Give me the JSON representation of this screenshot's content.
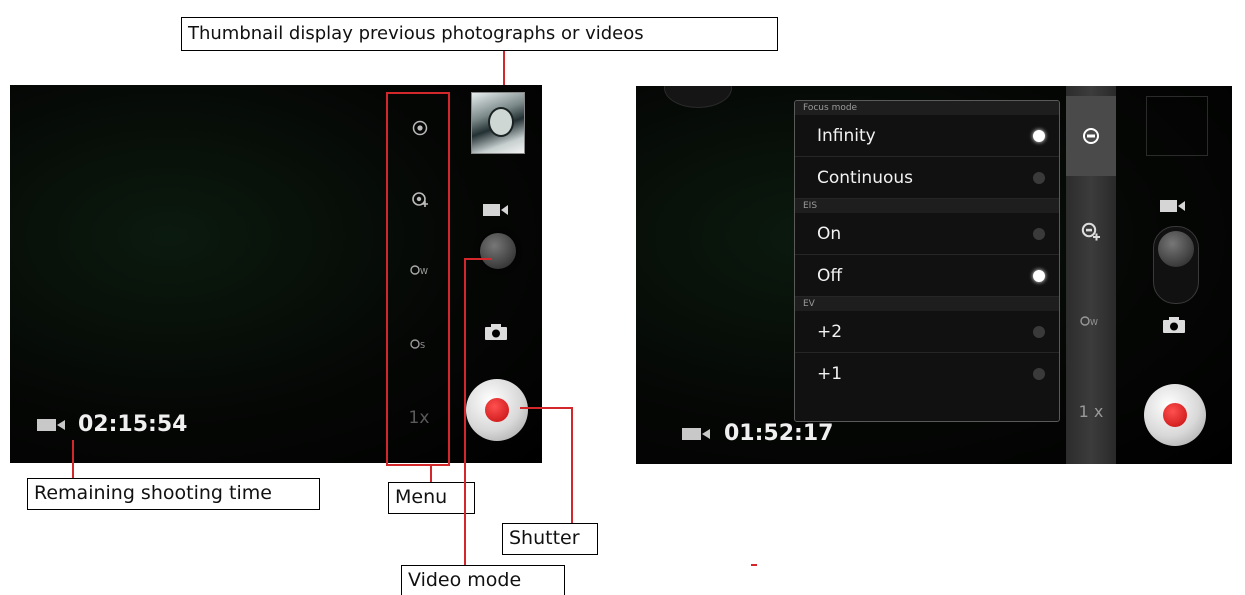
{
  "callouts": {
    "thumbnail": "Thumbnail display previous photographs or videos",
    "remaining": "Remaining shooting time",
    "menu": "Menu",
    "shutter": "Shutter",
    "video_mode": "Video mode"
  },
  "left_screen": {
    "timer": "02:15:54",
    "zoom_label": "1x"
  },
  "right_screen": {
    "timer": "01:52:17",
    "zoom_label": "1 x",
    "popup": {
      "sections": [
        {
          "title": "Focus mode",
          "options": [
            {
              "label": "Infinity",
              "selected": true
            },
            {
              "label": "Continuous",
              "selected": false
            }
          ]
        },
        {
          "title": "EIS",
          "options": [
            {
              "label": "On",
              "selected": false
            },
            {
              "label": "Off",
              "selected": true
            }
          ]
        },
        {
          "title": "EV",
          "options": [
            {
              "label": "+2",
              "selected": false
            },
            {
              "label": "+1",
              "selected": false
            }
          ]
        }
      ]
    }
  },
  "colors": {
    "annotation_red": "#d2272b",
    "record_red": "#d41414"
  }
}
